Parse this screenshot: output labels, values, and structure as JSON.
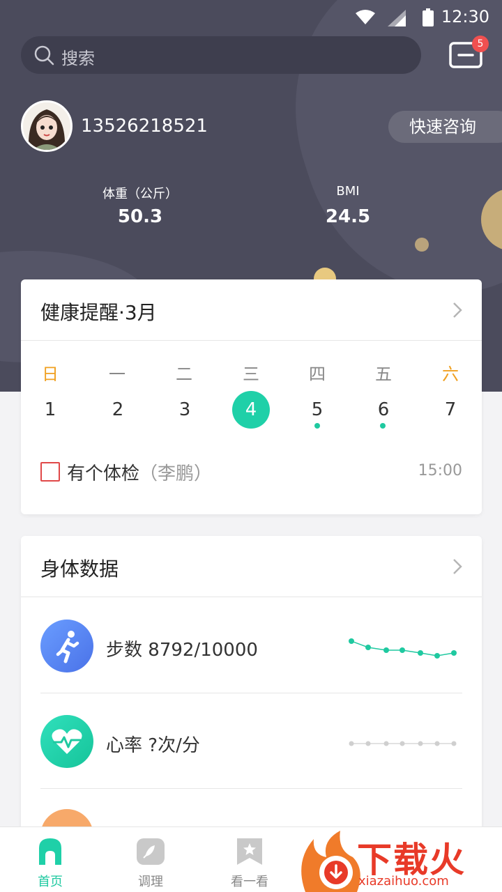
{
  "status_bar": {
    "time": "12:30"
  },
  "search": {
    "placeholder": "搜索"
  },
  "messages": {
    "badge_count": "5"
  },
  "profile": {
    "phone": "13526218521",
    "consult_button": "快速咨询"
  },
  "stats": [
    {
      "label": "体重（公斤）",
      "value": "50.3"
    },
    {
      "label": "BMI",
      "value": "24.5"
    }
  ],
  "health_reminder": {
    "title": "健康提醒·3月",
    "weekdays": [
      "日",
      "一",
      "二",
      "三",
      "四",
      "五",
      "六"
    ],
    "days": [
      "1",
      "2",
      "3",
      "4",
      "5",
      "6",
      "7"
    ],
    "selected_day": "4",
    "days_with_events": [
      "5",
      "6"
    ],
    "event": {
      "text": "有个体检",
      "person": "（李鹏）",
      "time": "15:00",
      "checked": false
    }
  },
  "body_data": {
    "title": "身体数据",
    "rows": [
      {
        "label": "步数",
        "value": "8792/10000",
        "icon": "running-person-icon"
      },
      {
        "label": "心率",
        "value": "?次/分",
        "icon": "heart-pulse-icon"
      }
    ]
  },
  "tabbar": {
    "items": [
      {
        "label": "首页",
        "icon": "home-icon",
        "active": true
      },
      {
        "label": "调理",
        "icon": "leaf-icon",
        "active": false
      },
      {
        "label": "看一看",
        "icon": "bookmark-star-icon",
        "active": false
      }
    ]
  },
  "watermark": {
    "text": "下载火",
    "url": "xiazaihuo.com"
  },
  "colors": {
    "accent": "#1fd0a8",
    "hero_bg": "#4b4b5c",
    "weekend": "#f0a020",
    "badge": "#f05050",
    "checkbox": "#e04848"
  }
}
